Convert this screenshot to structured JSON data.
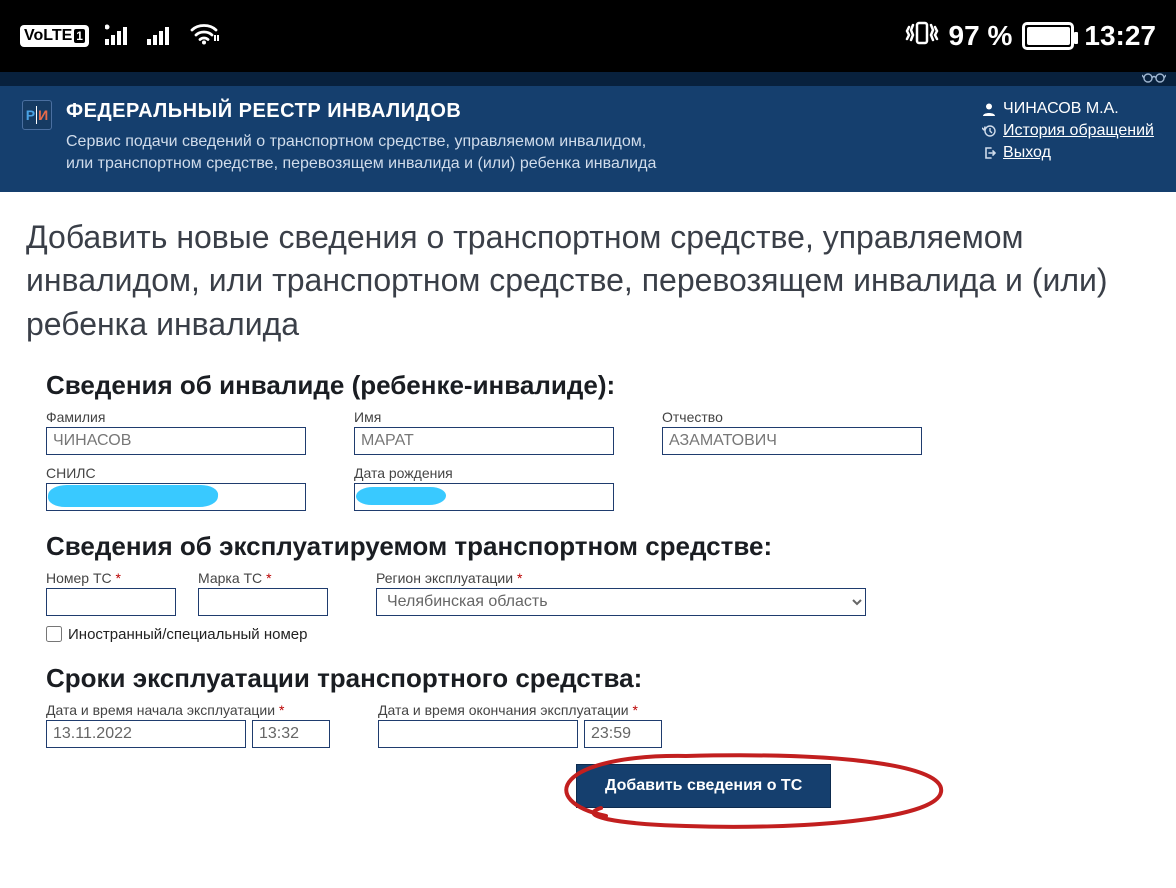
{
  "status": {
    "volte": "VoLTE",
    "sim": "1",
    "battery_pct": "97 %",
    "time": "13:27"
  },
  "header": {
    "title": "ФЕДЕРАЛЬНЫЙ РЕЕСТР ИНВАЛИДОВ",
    "subtitle_l1": "Сервис подачи сведений о транспортном средстве, управляемом инвалидом,",
    "subtitle_l2": "или транспортном средстве, перевозящем инвалида и (или) ребенка инвалида",
    "user_name": "ЧИНАСОВ М.А.",
    "history_link": "История обращений",
    "logout_link": "Выход"
  },
  "page": {
    "title": "Добавить новые сведения о транспортном средстве, управляемом инвалидом, или транспортном средстве, перевозящем инвалида и (или) ребенка инвалида"
  },
  "s1": {
    "heading": "Сведения об инвалиде (ребенке-инвалиде):",
    "lastname_label": "Фамилия",
    "lastname_value": "ЧИНАСОВ",
    "firstname_label": "Имя",
    "firstname_value": "МАРАТ",
    "patronymic_label": "Отчество",
    "patronymic_value": "АЗАМАТОВИЧ",
    "snils_label": "СНИЛС",
    "snils_value": "",
    "dob_label": "Дата рождения",
    "dob_value": ""
  },
  "s2": {
    "heading": "Сведения об эксплуатируемом транспортном средстве:",
    "number_label": "Номер ТС",
    "brand_label": "Марка ТС",
    "region_label": "Регион эксплуатации",
    "region_value": "Челябинская область",
    "foreign_label": "Иностранный/специальный номер"
  },
  "s3": {
    "heading": "Сроки эксплуатации транспортного средства:",
    "start_label": "Дата и время начала эксплуатации",
    "start_date": "13.11.2022",
    "start_time": "13:32",
    "end_label": "Дата и время окончания эксплуатации",
    "end_date": "",
    "end_time": "23:59",
    "submit": "Добавить сведения о ТС"
  }
}
